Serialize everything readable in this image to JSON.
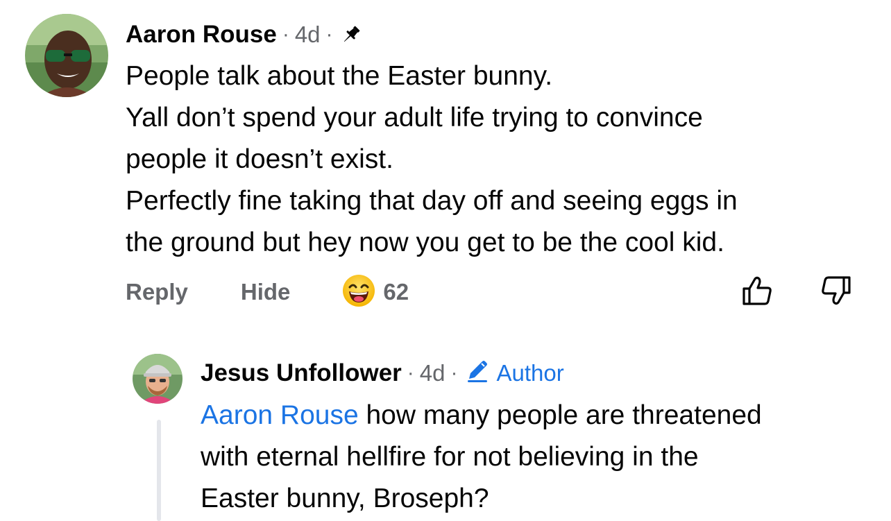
{
  "comment": {
    "author": "Aaron Rouse",
    "separator": "·",
    "time": "4d",
    "lines": [
      "People talk about the Easter bunny.",
      "Yall don’t spend your adult life trying to convince",
      "people it doesn’t exist.",
      "Perfectly fine taking that day off and seeing eggs in",
      "the ground but hey now you get to be the cool kid."
    ],
    "actions": {
      "reply_label": "Reply",
      "hide_label": "Hide",
      "reaction_icon": "laughing-face-icon",
      "reaction_count": "62"
    }
  },
  "reply": {
    "author": "Jesus Unfollower",
    "separator": "·",
    "time": "4d",
    "badge_label": "Author",
    "mention": "Aaron Rouse",
    "text_first_line_rest": " how many people are threatened",
    "lines_after": [
      "with eternal hellfire for not believing in the",
      "Easter bunny, Broseph?"
    ]
  },
  "colors": {
    "text_primary": "#050505",
    "text_secondary": "#65676b",
    "link_blue": "#1b74e4",
    "thread_line": "#e4e6eb"
  }
}
